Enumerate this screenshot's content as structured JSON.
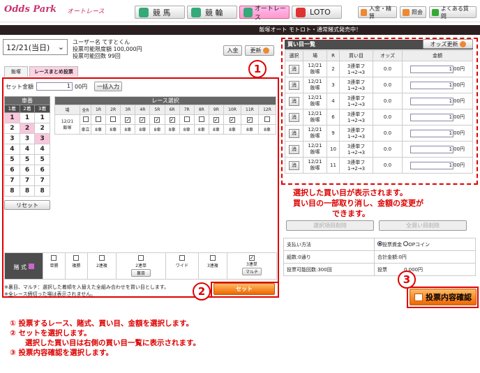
{
  "brand": {
    "logo": "Odds Park",
    "sub": "オートレース"
  },
  "nav": {
    "keiba": "競 馬",
    "keirin": "競 輪",
    "auto": "オートレース",
    "loto": "LOTO"
  },
  "top_links": {
    "deposit": "入金・精算",
    "inquiry": "照会",
    "faq": "よくある質問"
  },
  "notice": "飯塚オート モトロト・通常賭式発売中！",
  "date_select": "12/21(当日)",
  "user": {
    "name": "ユーザー名 てすとくん",
    "limit": "投票可能限度額 100,000円",
    "count": "投票可能回数 99回"
  },
  "buttons": {
    "deposit": "入金",
    "refresh": "更新",
    "bulk_input": "一括入力",
    "reset": "リセット",
    "set": "セット",
    "delete_selected": "選択項目削除",
    "delete_all": "全買い目削除",
    "confirm": "投票内容確認",
    "odds_refresh": "オッズ更新"
  },
  "tabs": {
    "iizuka": "飯塚",
    "matome": "レースまとめ投票"
  },
  "set_amount": {
    "label": "セット金額",
    "value": "1",
    "unit": "00円"
  },
  "car_panel": {
    "title": "車番",
    "cols": [
      "1着",
      "2着",
      "3着"
    ],
    "rows": [
      [
        "1",
        "1",
        "1"
      ],
      [
        "2",
        "2",
        "2"
      ],
      [
        "3",
        "3",
        "3"
      ],
      [
        "4",
        "4",
        "4"
      ],
      [
        "5",
        "5",
        "5"
      ],
      [
        "6",
        "6",
        "6"
      ],
      [
        "7",
        "7",
        "7"
      ],
      [
        "8",
        "8",
        "8"
      ]
    ]
  },
  "race_panel": {
    "title": "レース選択",
    "place_header": "場",
    "all_header": "全R",
    "races": [
      "1R",
      "2R",
      "3R",
      "4R",
      "5R",
      "6R",
      "7R",
      "8R",
      "9R",
      "10R",
      "11R",
      "12R"
    ],
    "checked": [
      false,
      false,
      true,
      true,
      true,
      true,
      false,
      false,
      true,
      true,
      true,
      false
    ],
    "date": "12/21",
    "place": "飯塚",
    "all_sub": "車立",
    "sub": "8車"
  },
  "bet_types": {
    "label": "賭 式",
    "items": [
      "単勝",
      "複勝",
      "2連複",
      "2連単",
      "ワイド",
      "3連複",
      "3連単"
    ],
    "sub_labels": {
      "3": "裏目",
      "6": "マルチ"
    },
    "checked_index": 6
  },
  "footnotes": [
    "※裏目、マルチ：選択した着順を入替えた全組み合わせを買い目とします。",
    "※全レース締切った場は表示されません。"
  ],
  "kaime": {
    "title": "買い目一覧",
    "headers": [
      "選択",
      "場",
      "R",
      "買い目",
      "オッズ",
      "金額"
    ],
    "rows": [
      {
        "date": "12/21",
        "place": "飯塚",
        "r": "2",
        "type": "3連単フ",
        "combo": "1→2→3",
        "odds": "0.0",
        "amount": "1",
        "unit": "00円"
      },
      {
        "date": "12/21",
        "place": "飯塚",
        "r": "3",
        "type": "3連単フ",
        "combo": "1→2→3",
        "odds": "0.0",
        "amount": "1",
        "unit": "00円"
      },
      {
        "date": "12/21",
        "place": "飯塚",
        "r": "4",
        "type": "3連単フ",
        "combo": "1→2→3",
        "odds": "0.0",
        "amount": "1",
        "unit": "00円"
      },
      {
        "date": "12/21",
        "place": "飯塚",
        "r": "6",
        "type": "3連単フ",
        "combo": "1→2→3",
        "odds": "0.0",
        "amount": "1",
        "unit": "00円"
      },
      {
        "date": "12/21",
        "place": "飯塚",
        "r": "9",
        "type": "3連単フ",
        "combo": "1→2→3",
        "odds": "0.0",
        "amount": "1",
        "unit": "00円"
      },
      {
        "date": "12/21",
        "place": "飯塚",
        "r": "10",
        "type": "3連単フ",
        "combo": "1→2→3",
        "odds": "0.0",
        "amount": "1",
        "unit": "00円"
      },
      {
        "date": "12/21",
        "place": "飯塚",
        "r": "11",
        "type": "3連単フ",
        "combo": "1→2→3",
        "odds": "0.0",
        "amount": "1",
        "unit": "00円"
      }
    ],
    "del": "消"
  },
  "payment": {
    "label": "支払い方法",
    "opt1": "投票資金",
    "opt2": "OPコイン",
    "count": "組数:0通り",
    "total": "合計金額:0円",
    "votes": "投票可能回数:300回",
    "balance_prefix": "投票",
    "balance_suffix": "0,000円"
  },
  "annotations": {
    "right": [
      "選択した買い目が表示されます。",
      "買い目の一部取り消し、金額の変更が",
      "できます。"
    ],
    "steps": [
      "①  投票するレース、賭式、買い目、金額を選択します。",
      "②  セットを選択します。",
      "選択した買い目は右側の買い目一覧に表示されます。",
      "③  投票内容確認を選択します。"
    ]
  },
  "markers": [
    "1",
    "2",
    "3"
  ]
}
